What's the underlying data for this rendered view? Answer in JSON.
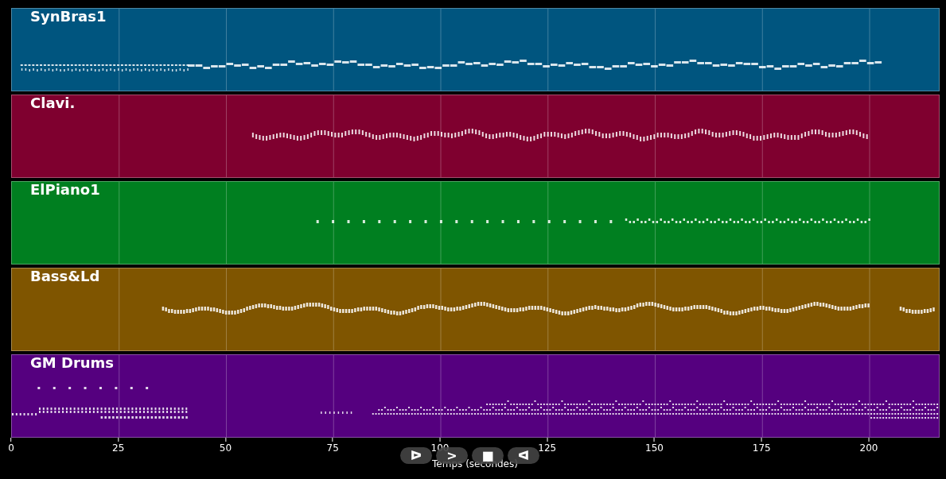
{
  "tracks": [
    {
      "name": "SynBras1",
      "color": "#00557f",
      "kind": "lead"
    },
    {
      "name": "Clavi.",
      "color": "#7f002f",
      "kind": "comp"
    },
    {
      "name": "ElPiano1",
      "color": "#007f20",
      "kind": "sparse"
    },
    {
      "name": "Bass&Ld",
      "color": "#7f5500",
      "kind": "bass"
    },
    {
      "name": "GM Drums",
      "color": "#55007f",
      "kind": "drums"
    }
  ],
  "x_axis": {
    "ticks": [
      "0",
      "25",
      "50",
      "75",
      "100",
      "125",
      "150",
      "175",
      "200"
    ],
    "label": "Temps (secondes)"
  },
  "player_buttons": [
    "ᐅ",
    ">",
    "■",
    "ᐊ"
  ]
}
